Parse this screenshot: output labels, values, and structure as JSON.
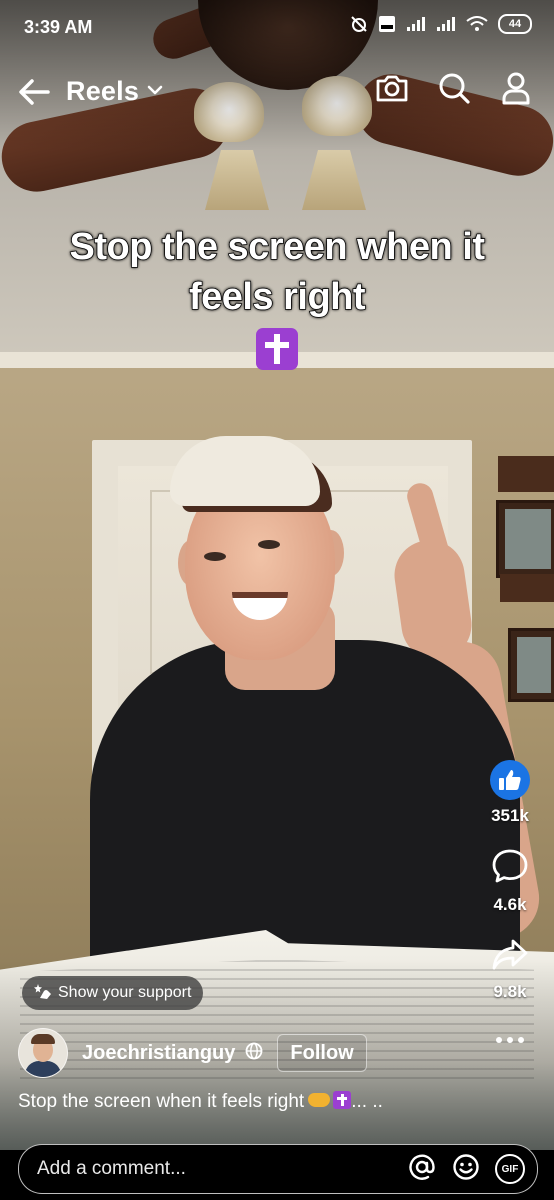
{
  "status_bar": {
    "time": "3:39 AM",
    "battery": "44",
    "icons": [
      "alarm-off-icon",
      "volte-icon",
      "signal-icon",
      "signal-icon",
      "wifi-icon",
      "battery-icon"
    ]
  },
  "header": {
    "title": "Reels",
    "icons": [
      "back-arrow-icon",
      "chevron-down-icon",
      "camera-icon",
      "search-icon",
      "profile-icon"
    ]
  },
  "video": {
    "caption": "Stop the screen when it feels right",
    "caption_emoji": "latin-cross-emoji"
  },
  "actions": {
    "likes": "351k",
    "comments": "4.6k",
    "shares": "9.8k",
    "icons": [
      "like-icon",
      "comment-icon",
      "share-icon",
      "more-icon"
    ]
  },
  "support": {
    "label": "Show your support"
  },
  "author": {
    "name": "Joechristianguy",
    "follow_label": "Follow",
    "privacy_icon": "globe-icon"
  },
  "description": {
    "text": "Stop the screen when it feels right",
    "ellipsis": "... .."
  },
  "comment": {
    "placeholder": "Add a comment...",
    "gif_label": "GIF",
    "icons": [
      "at-icon",
      "emoji-icon",
      "gif-icon"
    ]
  },
  "colors": {
    "like_blue": "#1b74e4",
    "cross_purple": "#9b3fd1"
  }
}
